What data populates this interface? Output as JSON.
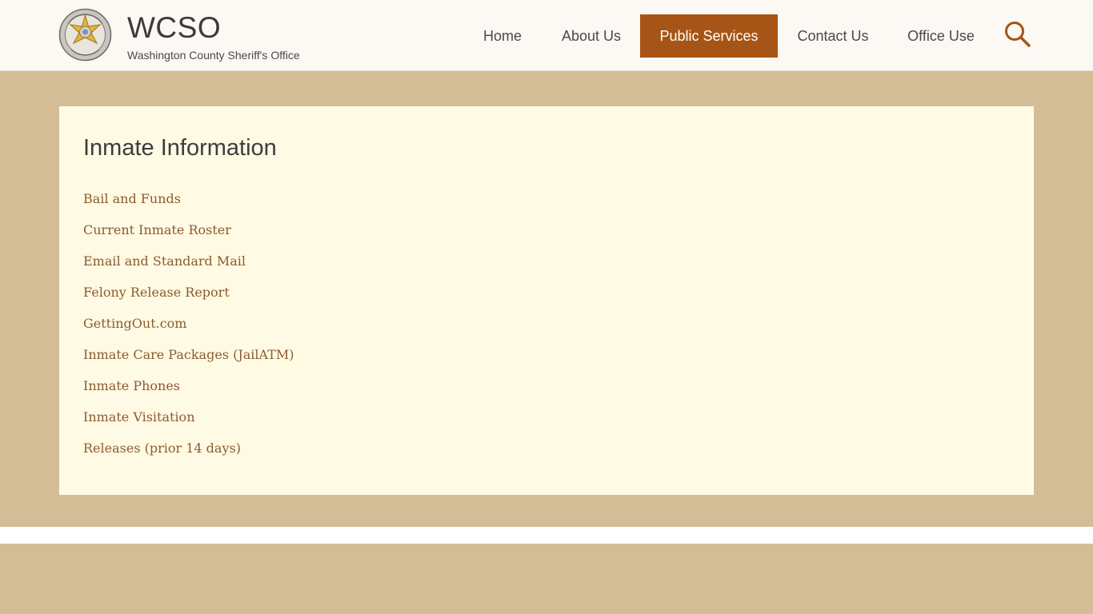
{
  "header": {
    "title": "WCSO",
    "subtitle": "Washington County Sheriff's Office",
    "logo_icon": "sheriff-star-badge-icon"
  },
  "nav": {
    "items": [
      {
        "label": "Home",
        "active": false
      },
      {
        "label": "About Us",
        "active": false
      },
      {
        "label": "Public Services",
        "active": true
      },
      {
        "label": "Contact Us",
        "active": false
      },
      {
        "label": "Office Use",
        "active": false
      }
    ],
    "search_icon": "search-icon"
  },
  "content": {
    "title": "Inmate Information",
    "links": [
      "Bail and Funds",
      "Current Inmate Roster",
      "Email and Standard Mail",
      "Felony Release Report",
      "GettingOut.com",
      "Inmate Care Packages (JailATM)",
      "Inmate Phones",
      "Inmate Visitation",
      "Releases (prior 14 days)"
    ]
  },
  "colors": {
    "accent": "#a65516",
    "band": "#d3bd97",
    "card": "#fffae3",
    "link": "#8c5b2e",
    "header_bg": "#fcf8f4"
  }
}
